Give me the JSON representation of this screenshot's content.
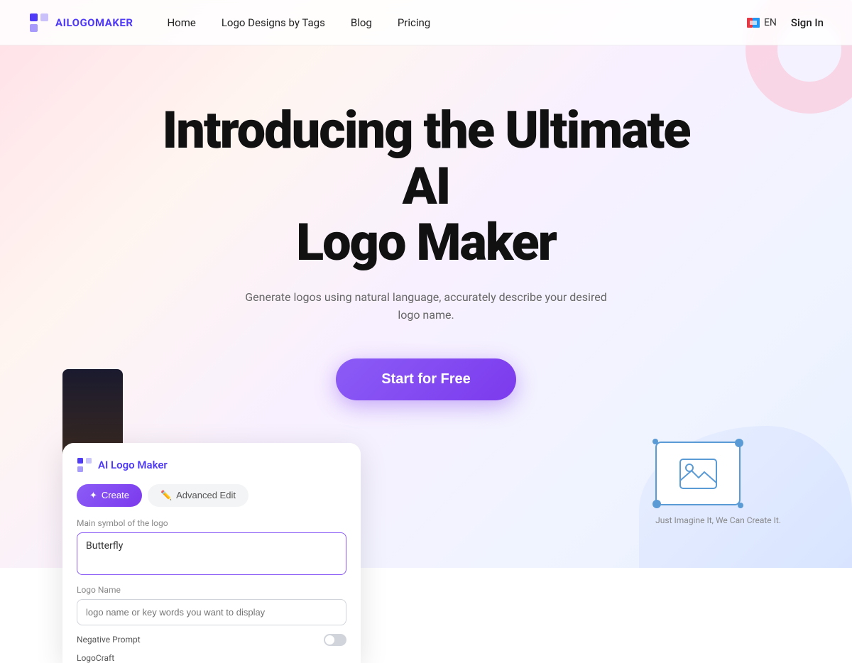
{
  "brand": {
    "logo_text": "AILOGOMAKER",
    "logo_icon_color": "#4f3af7"
  },
  "nav": {
    "home": "Home",
    "logo_designs": "Logo Designs by Tags",
    "blog": "Blog",
    "pricing": "Pricing",
    "lang": "EN",
    "sign_in": "Sign In"
  },
  "hero": {
    "title_line1": "Introducing the Ultimate AI",
    "title_line2": "Logo Maker",
    "subtitle": "Generate logos using natural language, accurately describe your desired logo name.",
    "cta": "Start for Free"
  },
  "preview": {
    "card_title": "AI Logo Maker",
    "tab_create": "Create",
    "tab_advanced": "Advanced Edit",
    "field1_label": "Main symbol of the logo",
    "field1_value": "Butterfly",
    "field2_label": "Logo Name",
    "field2_placeholder": "logo name or key words you want to display",
    "negative_prompt": "Negative Prompt",
    "logocraft": "LogoCraft",
    "imagine_text": "Just Imagine It, We Can Create It."
  }
}
